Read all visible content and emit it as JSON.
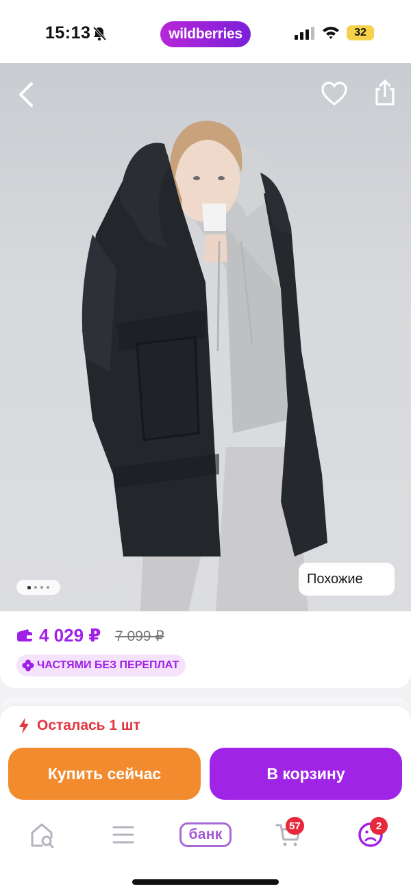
{
  "status_bar": {
    "time": "15:13",
    "battery": "32",
    "logo_text": "wildberries"
  },
  "product": {
    "gallery": {
      "image_count": 4,
      "current_index": 1,
      "similar_label": "Похожие"
    },
    "price": "4 029 ₽",
    "old_price": "7 099 ₽",
    "installment_label": "ЧАСТЯМИ БЕЗ ПЕРЕПЛАТ"
  },
  "purchase": {
    "stock_text": "Осталась 1 шт",
    "buy_now_label": "Купить сейчас",
    "add_to_cart_label": "В корзину"
  },
  "tab_bar": {
    "bank_label": "банк",
    "cart_badge": "57",
    "profile_badge": "2"
  },
  "colors": {
    "brand_purple": "#a024e6",
    "buy_orange": "#f28a2e",
    "alert_red": "#e4343e",
    "badge_red": "#e8283b"
  }
}
